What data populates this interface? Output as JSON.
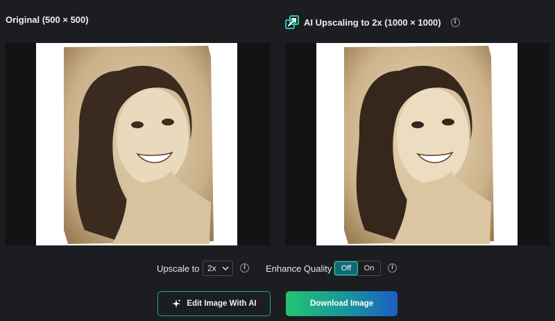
{
  "left_panel": {
    "title": "Original (500 × 500)"
  },
  "right_panel": {
    "title": "AI Upscaling to 2x (1000 × 1000)",
    "title_icon": "upscale-arrows-icon"
  },
  "info_glyph": "i",
  "controls": {
    "upscale_label": "Upscale to",
    "upscale_value": "2x",
    "enhance_label": "Enhance Quality",
    "enhance_off": "Off",
    "enhance_on": "On",
    "enhance_selected": "Off"
  },
  "buttons": {
    "edit_label": "Edit Image With AI",
    "download_label": "Download Image"
  },
  "colors": {
    "background": "#1b1d20",
    "accent_teal": "#1ed9a8",
    "download_gradient_start": "#21c571",
    "download_gradient_end": "#1c5fc4",
    "sepia": "#c9b08a"
  }
}
